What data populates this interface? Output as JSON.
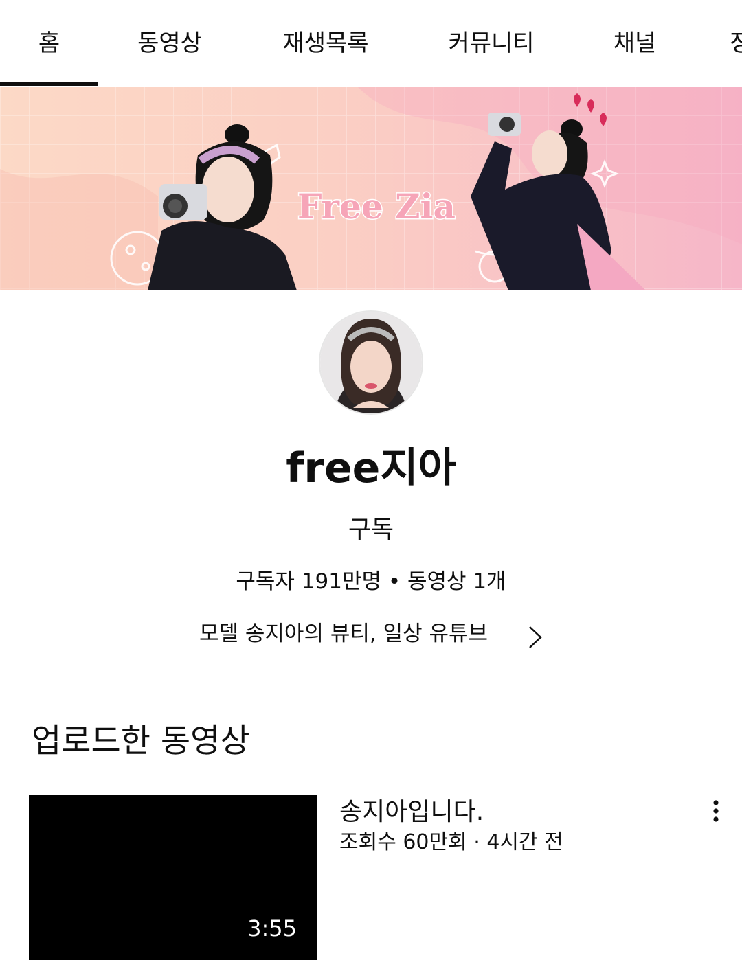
{
  "tabs": [
    {
      "label": "홈",
      "active": true
    },
    {
      "label": "동영상"
    },
    {
      "label": "재생목록"
    },
    {
      "label": "커뮤니티"
    },
    {
      "label": "채널"
    },
    {
      "label": "정"
    }
  ],
  "banner": {
    "logo_text": "Free Zia",
    "colors": {
      "bg_left": "#fbd2c2",
      "bg_right": "#f7b8c6",
      "logo": "#f6a5b8"
    }
  },
  "channel": {
    "name": "free지아",
    "subscribe_label": "구독",
    "stats": "구독자 191만명 • 동영상 1개",
    "description": "모델 송지아의 뷰티, 일상 유튜브"
  },
  "uploads": {
    "section_title": "업로드한 동영상",
    "videos": [
      {
        "title": "송지아입니다.",
        "meta": "조회수 60만회 · 4시간 전",
        "duration": "3:55"
      }
    ]
  },
  "icons": {
    "description_arrow": "chevron-right-icon",
    "video_menu": "more-vert-icon"
  }
}
